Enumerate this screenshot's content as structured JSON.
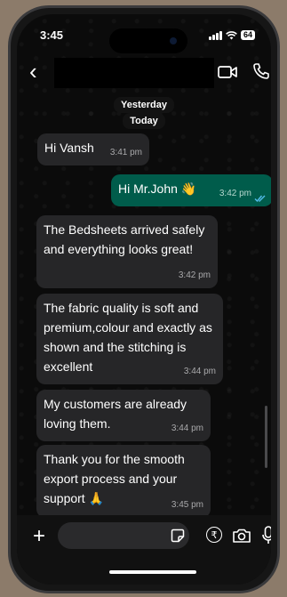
{
  "status": {
    "time": "3:45",
    "battery": "64"
  },
  "header": {
    "back_icon": "chevron-left-icon"
  },
  "chat": {
    "day_labels": [
      "Yesterday",
      "Today"
    ],
    "messages": [
      {
        "dir": "in",
        "text": "Hi Vansh",
        "time": "3:41 pm"
      },
      {
        "dir": "out",
        "text": "Hi Mr.John 👋",
        "time": "3:42 pm",
        "read": true
      },
      {
        "dir": "in",
        "text": "The Bedsheets arrived safely and everything looks great!",
        "time": "3:42 pm"
      },
      {
        "dir": "in",
        "text": "The fabric quality is soft and premium,colour and exactly as shown and the stitching is excellent",
        "time": "3:44 pm"
      },
      {
        "dir": "in",
        "text": "My customers are already loving them.",
        "time": "3:44 pm"
      },
      {
        "dir": "in",
        "text": "Thank you for the smooth export process and your support 🙏",
        "time": "3:45 pm"
      }
    ]
  },
  "composer": {
    "rupee_symbol": "₹"
  },
  "colors": {
    "incoming": "#262628",
    "outgoing": "#005c4b",
    "read_ticks": "#53bdeb"
  }
}
